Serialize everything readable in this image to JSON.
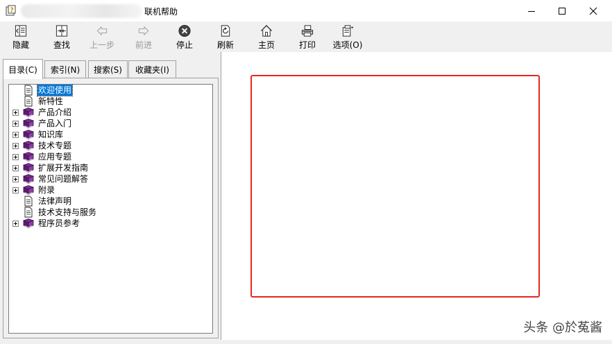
{
  "window": {
    "title": "联机帮助",
    "controls": [
      "minimize-icon",
      "maximize-icon",
      "close-icon"
    ]
  },
  "toolbar": {
    "buttons": [
      {
        "label": "隐藏",
        "icon": "hide-pane-icon",
        "enabled": true
      },
      {
        "label": "查找",
        "icon": "locate-icon",
        "enabled": true
      },
      {
        "label": "上一步",
        "icon": "back-arrow-icon",
        "enabled": false
      },
      {
        "label": "前进",
        "icon": "forward-arrow-icon",
        "enabled": false
      },
      {
        "label": "停止",
        "icon": "stop-icon",
        "enabled": true
      },
      {
        "label": "刷新",
        "icon": "refresh-icon",
        "enabled": true
      },
      {
        "label": "主页",
        "icon": "home-icon",
        "enabled": true
      },
      {
        "label": "打印",
        "icon": "print-icon",
        "enabled": true
      },
      {
        "label": "选项(O)",
        "icon": "options-icon",
        "enabled": true
      }
    ]
  },
  "tabs": [
    {
      "label": "目录(C)",
      "active": true
    },
    {
      "label": "索引(N)",
      "active": false
    },
    {
      "label": "搜索(S)",
      "active": false
    },
    {
      "label": "收藏夹(I)",
      "active": false
    }
  ],
  "tree": [
    {
      "label": "欢迎使用",
      "type": "page",
      "expandable": false,
      "selected": true
    },
    {
      "label": "新特性",
      "type": "page",
      "expandable": false,
      "selected": false
    },
    {
      "label": "产品介绍",
      "type": "book",
      "expandable": true,
      "selected": false
    },
    {
      "label": "产品入门",
      "type": "book",
      "expandable": true,
      "selected": false
    },
    {
      "label": "知识库",
      "type": "book",
      "expandable": true,
      "selected": false
    },
    {
      "label": "技术专题",
      "type": "book",
      "expandable": true,
      "selected": false
    },
    {
      "label": "应用专题",
      "type": "book",
      "expandable": true,
      "selected": false
    },
    {
      "label": "扩展开发指南",
      "type": "book",
      "expandable": true,
      "selected": false
    },
    {
      "label": "常见问题解答",
      "type": "book",
      "expandable": true,
      "selected": false
    },
    {
      "label": "附录",
      "type": "book",
      "expandable": true,
      "selected": false
    },
    {
      "label": "法律声明",
      "type": "page",
      "expandable": false,
      "selected": false
    },
    {
      "label": "技术支持与服务",
      "type": "page",
      "expandable": false,
      "selected": false
    },
    {
      "label": "程序员参考",
      "type": "book",
      "expandable": true,
      "selected": false
    }
  ],
  "annotation": {
    "color": "#e52620"
  },
  "watermark": "头条 @於菟酱"
}
